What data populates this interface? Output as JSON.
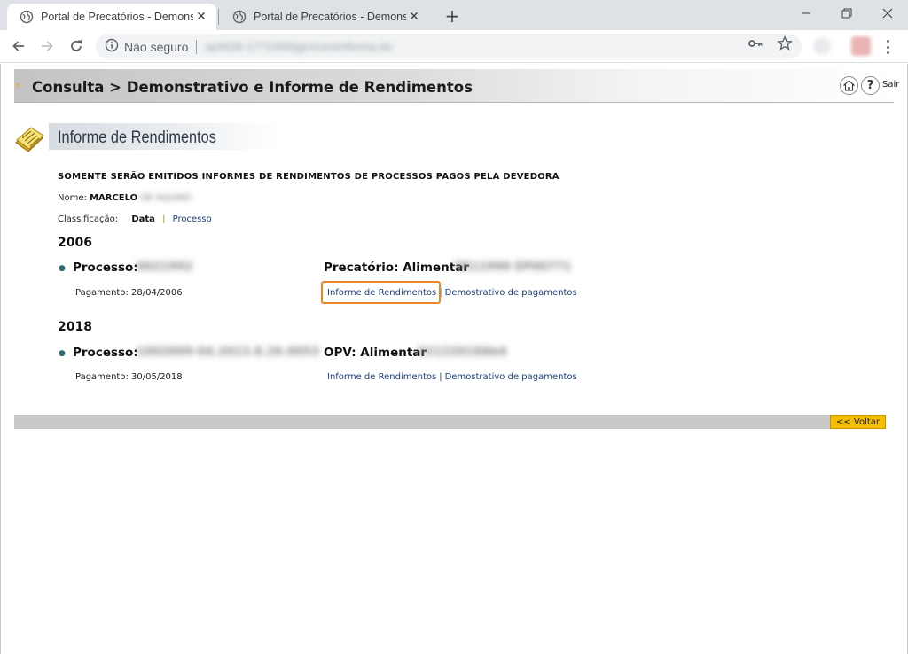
{
  "browser": {
    "tabs": [
      {
        "title": "Portal de Precatórios - Demonstr"
      },
      {
        "title": "Portal de Precatórios - Demonstr"
      }
    ],
    "address": {
      "security_label": "Não seguro",
      "url": "sp4626-1771000/jgc/consInforma.do"
    }
  },
  "header": {
    "title": "Consulta > Demonstrativo e Informe de Rendimentos",
    "logout_label": "Sair",
    "help_label": "?"
  },
  "section": {
    "title": "Informe de Rendimentos"
  },
  "notice": "SOMENTE SERÃO EMITIDOS INFORMES DE RENDIMENTOS DE PROCESSOS PAGOS PELA DEVEDORA",
  "beneficiary": {
    "name_label": "Nome:",
    "first_name": "MARCELO",
    "rest_name": "DE AQUINO"
  },
  "classification": {
    "label": "Classificação:",
    "selected": "Data",
    "other": "Processo"
  },
  "groups": [
    {
      "year": "2006",
      "process_label": "Processo:",
      "process_value": "0021992",
      "precatorio_label": "Precatório: Alimentar",
      "precatorio_value": "TR11998 EP00771",
      "payment": "Pagamento: 28/04/2006",
      "link_informe": "Informe de Rendimentos",
      "link_demo": "Demostrativo de pagamentos"
    },
    {
      "year": "2018",
      "process_label": "Processo:",
      "process_value": "1002009-04.2013.8.26.0053",
      "precatorio_label": "OPV: Alimentar",
      "precatorio_value": "02122018Ab4",
      "payment": "Pagamento: 30/05/2018",
      "link_informe": "Informe de Rendimentos",
      "link_demo": "Demostrativo de pagamentos"
    }
  ],
  "footer": {
    "back_label": "<< Voltar"
  },
  "colors": {
    "highlight": "#e8862a",
    "back_button": "#f7bd00",
    "link": "#1a3f80"
  }
}
